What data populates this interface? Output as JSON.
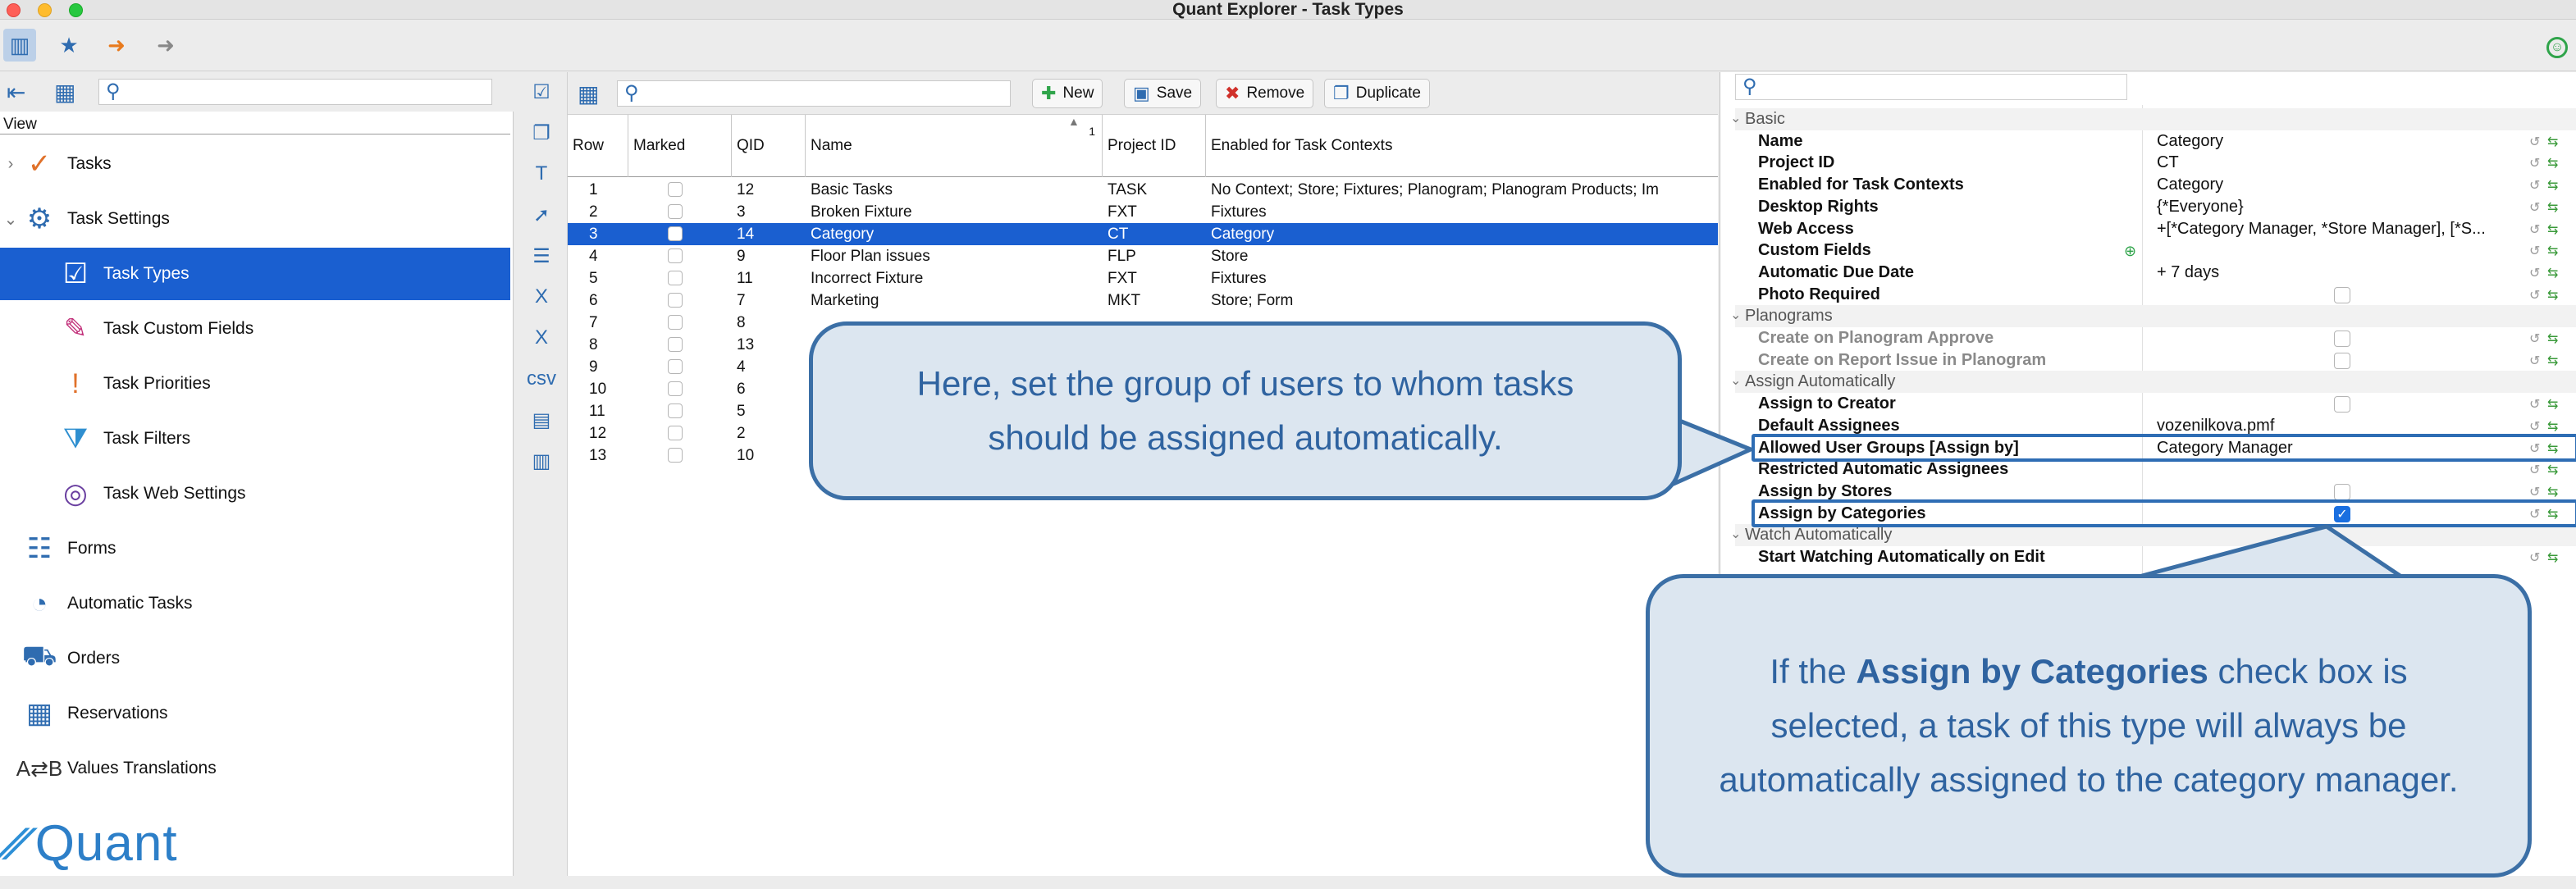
{
  "window": {
    "title": "Quant Explorer - Task Types"
  },
  "left": {
    "view_label": "View",
    "nav": [
      {
        "label": "Tasks",
        "icon": "tasks-icon"
      },
      {
        "label": "Task Settings",
        "icon": "task-settings-icon"
      },
      {
        "label": "Task Types",
        "icon": "task-types-icon"
      },
      {
        "label": "Task Custom Fields",
        "icon": "task-custom-fields-icon"
      },
      {
        "label": "Task Priorities",
        "icon": "task-priorities-icon"
      },
      {
        "label": "Task Filters",
        "icon": "task-filters-icon"
      },
      {
        "label": "Task Web Settings",
        "icon": "task-web-settings-icon"
      },
      {
        "label": "Forms",
        "icon": "forms-icon"
      },
      {
        "label": "Automatic Tasks",
        "icon": "automatic-tasks-icon"
      },
      {
        "label": "Orders",
        "icon": "orders-icon"
      },
      {
        "label": "Reservations",
        "icon": "reservations-icon"
      },
      {
        "label": "Values Translations",
        "icon": "values-translations-icon"
      }
    ],
    "logo": "Quant"
  },
  "center": {
    "buttons": {
      "new": "New",
      "save": "Save",
      "remove": "Remove",
      "duplicate": "Duplicate"
    },
    "columns": {
      "row": "Row",
      "marked": "Marked",
      "qid": "QID",
      "name": "Name",
      "sort": "1",
      "project": "Project ID",
      "contexts": "Enabled for Task Contexts"
    },
    "rows": [
      {
        "row": "1",
        "qid": "12",
        "name": "Basic Tasks",
        "project": "TASK",
        "contexts": "No Context; Store; Fixtures; Planogram; Planogram Products; Im"
      },
      {
        "row": "2",
        "qid": "3",
        "name": "Broken Fixture",
        "project": "FXT",
        "contexts": "Fixtures"
      },
      {
        "row": "3",
        "qid": "14",
        "name": "Category",
        "project": "CT",
        "contexts": "Category"
      },
      {
        "row": "4",
        "qid": "9",
        "name": "Floor Plan issues",
        "project": "FLP",
        "contexts": "Store"
      },
      {
        "row": "5",
        "qid": "11",
        "name": "Incorrect Fixture",
        "project": "FXT",
        "contexts": "Fixtures"
      },
      {
        "row": "6",
        "qid": "7",
        "name": "Marketing",
        "project": "MKT",
        "contexts": "Store; Form"
      },
      {
        "row": "7",
        "qid": "8",
        "name": "",
        "project": "",
        "contexts": ""
      },
      {
        "row": "8",
        "qid": "13",
        "name": "",
        "project": "",
        "contexts": ""
      },
      {
        "row": "9",
        "qid": "4",
        "name": "",
        "project": "",
        "contexts": ""
      },
      {
        "row": "10",
        "qid": "6",
        "name": "",
        "project": "",
        "contexts": ""
      },
      {
        "row": "11",
        "qid": "5",
        "name": "",
        "project": "",
        "contexts": ""
      },
      {
        "row": "12",
        "qid": "2",
        "name": "",
        "project": "",
        "contexts": ""
      },
      {
        "row": "13",
        "qid": "10",
        "name": "",
        "project": "",
        "contexts": ""
      }
    ]
  },
  "props": [
    {
      "type": "group",
      "name": "Basic"
    },
    {
      "name": "Name",
      "value": "Category"
    },
    {
      "name": "Project ID",
      "value": "CT"
    },
    {
      "name": "Enabled for Task Contexts",
      "value": "Category"
    },
    {
      "name": "Desktop Rights",
      "value": "{*Everyone}"
    },
    {
      "name": "Web Access",
      "value": "+[*Category Manager, *Store Manager], [*S..."
    },
    {
      "name": "Custom Fields",
      "value": ""
    },
    {
      "name": "Automatic Due Date",
      "value": "+ 7 days"
    },
    {
      "name": "Photo Required",
      "value": "",
      "checkbox": "off"
    },
    {
      "type": "group",
      "name": "Planograms"
    },
    {
      "name": "Create on Planogram Approve",
      "value": "",
      "checkbox": "off",
      "dim": true
    },
    {
      "name": "Create on Report Issue in Planogram",
      "value": "",
      "checkbox": "off",
      "dim": true
    },
    {
      "type": "group",
      "name": "Assign Automatically"
    },
    {
      "name": "Assign to Creator",
      "value": "",
      "checkbox": "off"
    },
    {
      "name": "Default Assignees",
      "value": "vozenilkova.pmf"
    },
    {
      "name": "Allowed User Groups [Assign by]",
      "value": "Category Manager"
    },
    {
      "name": "Restricted Automatic Assignees",
      "value": ""
    },
    {
      "name": "Assign by Stores",
      "value": "",
      "checkbox": "off"
    },
    {
      "name": "Assign by Categories",
      "value": "",
      "checkbox": "on"
    },
    {
      "type": "group",
      "name": "Watch Automatically"
    },
    {
      "name": "Start Watching Automatically on Edit",
      "value": ""
    }
  ],
  "callouts": {
    "c1": "Here, set the group of users to whom tasks should be assigned automatically.",
    "c2_pre": "If the ",
    "c2_bold": "Assign by Categories",
    "c2_post": " check box is selected, a task of this type will always be automatically assigned to the category manager."
  },
  "colors": {
    "selection": "#1a5fd0",
    "callout_border": "#3b6fa6",
    "callout_fill": "#dce6f0"
  }
}
